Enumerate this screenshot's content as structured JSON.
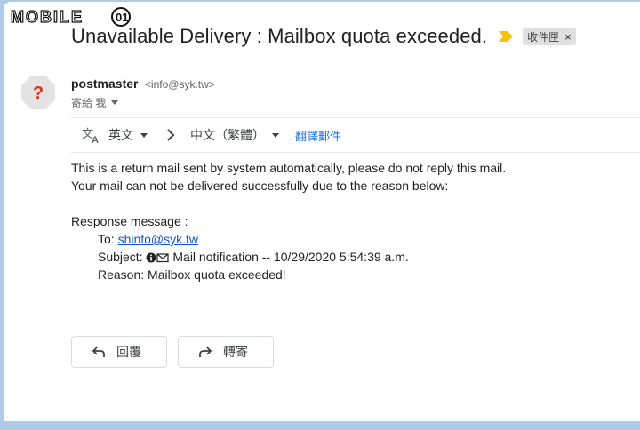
{
  "watermark": {
    "text": "MOBILE"
  },
  "header": {
    "subject": "Unavailable Delivery : Mailbox quota exceeded.",
    "label": "收件匣",
    "label_close": "×"
  },
  "sender": {
    "name": "postmaster",
    "email": "<info@syk.tw>",
    "to_text": "寄給 我",
    "avatar_symbol": "?"
  },
  "translate": {
    "source_lang": "英文",
    "target_lang": "中文（繁體）",
    "action": "翻譯郵件"
  },
  "body": {
    "line1": "This is a return mail sent by system automatically, please do not reply this mail.",
    "line2": "Your mail can not be delivered successfully due to the reason below:",
    "response_label": "Response message :",
    "to_label": "To: ",
    "to_value": "shinfo@syk.tw",
    "subject_label": "Subject: ",
    "subject_value": "Mail notification --  10/29/2020 5:54:39 a.m.",
    "reason": "Reason: Mailbox quota exceeded!"
  },
  "actions": {
    "reply": "回覆",
    "forward": "轉寄"
  },
  "colors": {
    "background": "#aecbe8",
    "link": "#1155cc",
    "important_marker": "#f4c20d",
    "avatar_bg": "#e3e3e3",
    "avatar_symbol": "#d93025"
  }
}
